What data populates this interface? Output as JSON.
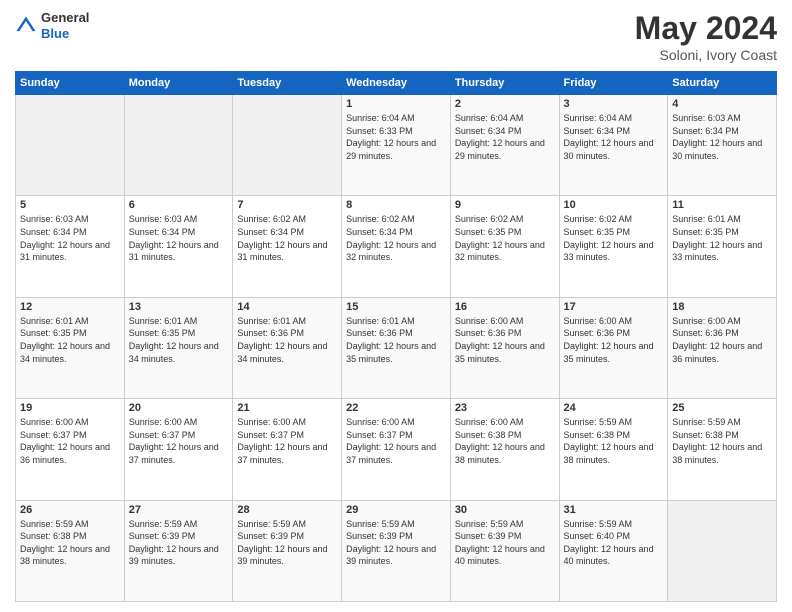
{
  "header": {
    "logo": {
      "general": "General",
      "blue": "Blue"
    },
    "title": "May 2024",
    "location": "Soloni, Ivory Coast"
  },
  "weekdays": [
    "Sunday",
    "Monday",
    "Tuesday",
    "Wednesday",
    "Thursday",
    "Friday",
    "Saturday"
  ],
  "weeks": [
    [
      {
        "day": "",
        "sunrise": "",
        "sunset": "",
        "daylight": "",
        "empty": true
      },
      {
        "day": "",
        "sunrise": "",
        "sunset": "",
        "daylight": "",
        "empty": true
      },
      {
        "day": "",
        "sunrise": "",
        "sunset": "",
        "daylight": "",
        "empty": true
      },
      {
        "day": "1",
        "sunrise": "Sunrise: 6:04 AM",
        "sunset": "Sunset: 6:33 PM",
        "daylight": "Daylight: 12 hours and 29 minutes."
      },
      {
        "day": "2",
        "sunrise": "Sunrise: 6:04 AM",
        "sunset": "Sunset: 6:34 PM",
        "daylight": "Daylight: 12 hours and 29 minutes."
      },
      {
        "day": "3",
        "sunrise": "Sunrise: 6:04 AM",
        "sunset": "Sunset: 6:34 PM",
        "daylight": "Daylight: 12 hours and 30 minutes."
      },
      {
        "day": "4",
        "sunrise": "Sunrise: 6:03 AM",
        "sunset": "Sunset: 6:34 PM",
        "daylight": "Daylight: 12 hours and 30 minutes."
      }
    ],
    [
      {
        "day": "5",
        "sunrise": "Sunrise: 6:03 AM",
        "sunset": "Sunset: 6:34 PM",
        "daylight": "Daylight: 12 hours and 31 minutes."
      },
      {
        "day": "6",
        "sunrise": "Sunrise: 6:03 AM",
        "sunset": "Sunset: 6:34 PM",
        "daylight": "Daylight: 12 hours and 31 minutes."
      },
      {
        "day": "7",
        "sunrise": "Sunrise: 6:02 AM",
        "sunset": "Sunset: 6:34 PM",
        "daylight": "Daylight: 12 hours and 31 minutes."
      },
      {
        "day": "8",
        "sunrise": "Sunrise: 6:02 AM",
        "sunset": "Sunset: 6:34 PM",
        "daylight": "Daylight: 12 hours and 32 minutes."
      },
      {
        "day": "9",
        "sunrise": "Sunrise: 6:02 AM",
        "sunset": "Sunset: 6:35 PM",
        "daylight": "Daylight: 12 hours and 32 minutes."
      },
      {
        "day": "10",
        "sunrise": "Sunrise: 6:02 AM",
        "sunset": "Sunset: 6:35 PM",
        "daylight": "Daylight: 12 hours and 33 minutes."
      },
      {
        "day": "11",
        "sunrise": "Sunrise: 6:01 AM",
        "sunset": "Sunset: 6:35 PM",
        "daylight": "Daylight: 12 hours and 33 minutes."
      }
    ],
    [
      {
        "day": "12",
        "sunrise": "Sunrise: 6:01 AM",
        "sunset": "Sunset: 6:35 PM",
        "daylight": "Daylight: 12 hours and 34 minutes."
      },
      {
        "day": "13",
        "sunrise": "Sunrise: 6:01 AM",
        "sunset": "Sunset: 6:35 PM",
        "daylight": "Daylight: 12 hours and 34 minutes."
      },
      {
        "day": "14",
        "sunrise": "Sunrise: 6:01 AM",
        "sunset": "Sunset: 6:36 PM",
        "daylight": "Daylight: 12 hours and 34 minutes."
      },
      {
        "day": "15",
        "sunrise": "Sunrise: 6:01 AM",
        "sunset": "Sunset: 6:36 PM",
        "daylight": "Daylight: 12 hours and 35 minutes."
      },
      {
        "day": "16",
        "sunrise": "Sunrise: 6:00 AM",
        "sunset": "Sunset: 6:36 PM",
        "daylight": "Daylight: 12 hours and 35 minutes."
      },
      {
        "day": "17",
        "sunrise": "Sunrise: 6:00 AM",
        "sunset": "Sunset: 6:36 PM",
        "daylight": "Daylight: 12 hours and 35 minutes."
      },
      {
        "day": "18",
        "sunrise": "Sunrise: 6:00 AM",
        "sunset": "Sunset: 6:36 PM",
        "daylight": "Daylight: 12 hours and 36 minutes."
      }
    ],
    [
      {
        "day": "19",
        "sunrise": "Sunrise: 6:00 AM",
        "sunset": "Sunset: 6:37 PM",
        "daylight": "Daylight: 12 hours and 36 minutes."
      },
      {
        "day": "20",
        "sunrise": "Sunrise: 6:00 AM",
        "sunset": "Sunset: 6:37 PM",
        "daylight": "Daylight: 12 hours and 37 minutes."
      },
      {
        "day": "21",
        "sunrise": "Sunrise: 6:00 AM",
        "sunset": "Sunset: 6:37 PM",
        "daylight": "Daylight: 12 hours and 37 minutes."
      },
      {
        "day": "22",
        "sunrise": "Sunrise: 6:00 AM",
        "sunset": "Sunset: 6:37 PM",
        "daylight": "Daylight: 12 hours and 37 minutes."
      },
      {
        "day": "23",
        "sunrise": "Sunrise: 6:00 AM",
        "sunset": "Sunset: 6:38 PM",
        "daylight": "Daylight: 12 hours and 38 minutes."
      },
      {
        "day": "24",
        "sunrise": "Sunrise: 5:59 AM",
        "sunset": "Sunset: 6:38 PM",
        "daylight": "Daylight: 12 hours and 38 minutes."
      },
      {
        "day": "25",
        "sunrise": "Sunrise: 5:59 AM",
        "sunset": "Sunset: 6:38 PM",
        "daylight": "Daylight: 12 hours and 38 minutes."
      }
    ],
    [
      {
        "day": "26",
        "sunrise": "Sunrise: 5:59 AM",
        "sunset": "Sunset: 6:38 PM",
        "daylight": "Daylight: 12 hours and 38 minutes."
      },
      {
        "day": "27",
        "sunrise": "Sunrise: 5:59 AM",
        "sunset": "Sunset: 6:39 PM",
        "daylight": "Daylight: 12 hours and 39 minutes."
      },
      {
        "day": "28",
        "sunrise": "Sunrise: 5:59 AM",
        "sunset": "Sunset: 6:39 PM",
        "daylight": "Daylight: 12 hours and 39 minutes."
      },
      {
        "day": "29",
        "sunrise": "Sunrise: 5:59 AM",
        "sunset": "Sunset: 6:39 PM",
        "daylight": "Daylight: 12 hours and 39 minutes."
      },
      {
        "day": "30",
        "sunrise": "Sunrise: 5:59 AM",
        "sunset": "Sunset: 6:39 PM",
        "daylight": "Daylight: 12 hours and 40 minutes."
      },
      {
        "day": "31",
        "sunrise": "Sunrise: 5:59 AM",
        "sunset": "Sunset: 6:40 PM",
        "daylight": "Daylight: 12 hours and 40 minutes."
      },
      {
        "day": "",
        "sunrise": "",
        "sunset": "",
        "daylight": "",
        "empty": true
      }
    ]
  ]
}
